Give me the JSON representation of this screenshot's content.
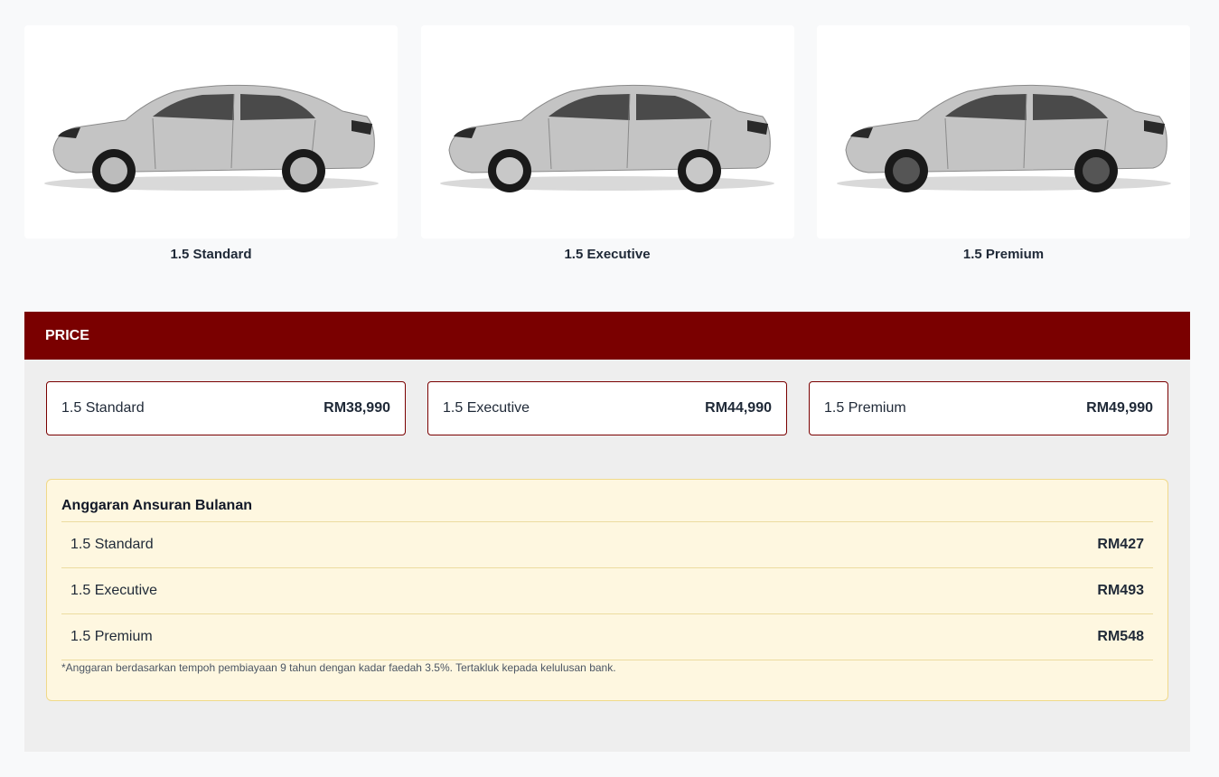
{
  "variants": [
    {
      "name": "1.5 Standard"
    },
    {
      "name": "1.5 Executive"
    },
    {
      "name": "1.5 Premium"
    }
  ],
  "price": {
    "header": "PRICE",
    "items": [
      {
        "name": "1.5 Standard",
        "price": "RM38,990"
      },
      {
        "name": "1.5 Executive",
        "price": "RM44,990"
      },
      {
        "name": "1.5 Premium",
        "price": "RM49,990"
      }
    ]
  },
  "installment": {
    "title": "Anggaran Ansuran Bulanan",
    "rows": [
      {
        "name": "1.5 Standard",
        "value": "RM427"
      },
      {
        "name": "1.5 Executive",
        "value": "RM493"
      },
      {
        "name": "1.5 Premium",
        "value": "RM548"
      }
    ],
    "note": "*Anggaran berdasarkan tempoh pembiayaan 9 tahun dengan kadar faedah 3.5%. Tertakluk kepada kelulusan bank."
  },
  "colors": {
    "brand": "#7a0000",
    "installment_bg": "#fef7e0",
    "section_bg": "#eeeeee"
  }
}
